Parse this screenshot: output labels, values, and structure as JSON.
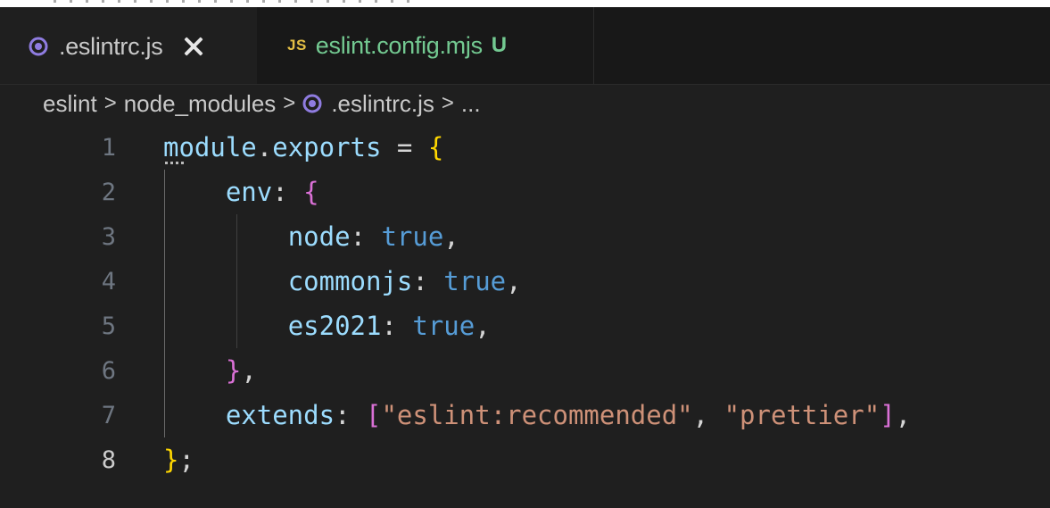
{
  "tabs": [
    {
      "label": ".eslintrc.js",
      "icon": "eslint-icon",
      "active": true,
      "close": "close-icon"
    },
    {
      "label": "eslint.config.mjs",
      "icon_text": "JS",
      "status": "U",
      "active": false
    }
  ],
  "breadcrumb": {
    "items": [
      "eslint",
      "node_modules",
      ".eslintrc.js",
      "..."
    ],
    "separator": ">"
  },
  "editor": {
    "current_line": "8",
    "lines": [
      {
        "n": "1",
        "tokens": [
          [
            "module",
            "var"
          ],
          [
            ".",
            "op"
          ],
          [
            "exports",
            "var"
          ],
          [
            " = ",
            "op"
          ],
          [
            "{",
            "b1"
          ]
        ]
      },
      {
        "n": "2",
        "tokens": [
          [
            "    ",
            "op"
          ],
          [
            "env",
            "var"
          ],
          [
            ": ",
            "op"
          ],
          [
            "{",
            "b2"
          ]
        ]
      },
      {
        "n": "3",
        "tokens": [
          [
            "        ",
            "op"
          ],
          [
            "node",
            "var"
          ],
          [
            ": ",
            "op"
          ],
          [
            "true",
            "bool"
          ],
          [
            ",",
            "op"
          ]
        ]
      },
      {
        "n": "4",
        "tokens": [
          [
            "        ",
            "op"
          ],
          [
            "commonjs",
            "var"
          ],
          [
            ": ",
            "op"
          ],
          [
            "true",
            "bool"
          ],
          [
            ",",
            "op"
          ]
        ]
      },
      {
        "n": "5",
        "tokens": [
          [
            "        ",
            "op"
          ],
          [
            "es2021",
            "var"
          ],
          [
            ": ",
            "op"
          ],
          [
            "true",
            "bool"
          ],
          [
            ",",
            "op"
          ]
        ]
      },
      {
        "n": "6",
        "tokens": [
          [
            "    ",
            "op"
          ],
          [
            "}",
            "b2"
          ],
          [
            ",",
            "op"
          ]
        ]
      },
      {
        "n": "7",
        "tokens": [
          [
            "    ",
            "op"
          ],
          [
            "extends",
            "var"
          ],
          [
            ": ",
            "op"
          ],
          [
            "[",
            "b2"
          ],
          [
            "\"eslint:recommended\"",
            "str"
          ],
          [
            ", ",
            "op"
          ],
          [
            "\"prettier\"",
            "str"
          ],
          [
            "]",
            "b2"
          ],
          [
            ",",
            "op"
          ]
        ]
      },
      {
        "n": "8",
        "tokens": [
          [
            "}",
            "b1"
          ],
          [
            ";",
            "op"
          ]
        ]
      }
    ]
  },
  "colors": {
    "background": "#1f1f1f",
    "tab_bar": "#181818",
    "untracked": "#73c991",
    "js_badge": "#e5c045",
    "eslint_icon": "#8f7ce0"
  }
}
